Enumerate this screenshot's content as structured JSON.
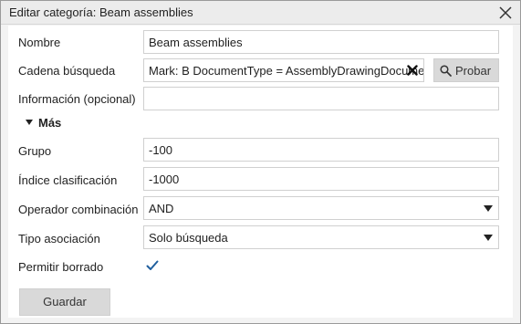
{
  "dialog": {
    "title": "Editar categoría: Beam assemblies"
  },
  "form": {
    "name": {
      "label": "Nombre",
      "value": "Beam assemblies"
    },
    "search": {
      "label": "Cadena búsqueda",
      "value": "Mark: B DocumentType = AssemblyDrawingDocument"
    },
    "test_button": {
      "label": "Probar"
    },
    "info": {
      "label": "Información (opcional)",
      "value": ""
    },
    "more_section": {
      "label": "Más"
    },
    "group": {
      "label": "Grupo",
      "value": "-100"
    },
    "sort_index": {
      "label": "Índice clasificación",
      "value": "-1000"
    },
    "combine_operator": {
      "label": "Operador combinación",
      "value": "AND"
    },
    "association_type": {
      "label": "Tipo asociación",
      "value": "Solo búsqueda"
    },
    "allow_delete": {
      "label": "Permitir borrado",
      "checked": true
    },
    "save_button": {
      "label": "Guardar"
    }
  },
  "icons": {
    "close": "close-icon",
    "clear": "clear-x-icon",
    "search": "search-icon",
    "dropdown": "chevron-down-icon",
    "check": "checkmark-icon"
  },
  "colors": {
    "checkmark": "#1f5f9e",
    "button_bg": "#d9d9d9",
    "dialog_bg": "#f3f3f3"
  }
}
